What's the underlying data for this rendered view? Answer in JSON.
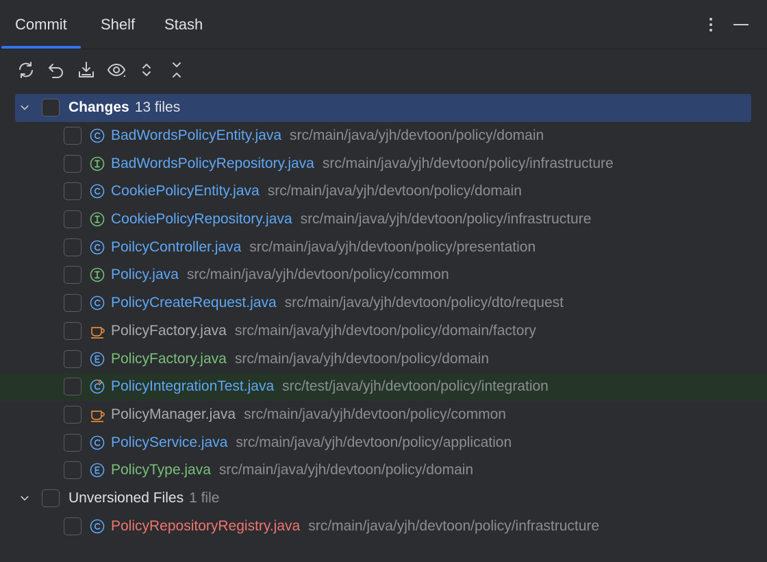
{
  "tabs": [
    {
      "label": "Commit",
      "active": true
    },
    {
      "label": "Shelf",
      "active": false
    },
    {
      "label": "Stash",
      "active": false
    }
  ],
  "header_actions": [
    "more-options-icon",
    "minimize-icon"
  ],
  "toolbar": [
    "refresh-icon",
    "rollback-icon",
    "update-project-icon",
    "view-options-icon",
    "expand-all-icon",
    "collapse-all-icon"
  ],
  "groups": [
    {
      "title": "Changes",
      "count": "13 files",
      "files": [
        {
          "name": "BadWordsPolicyEntity.java",
          "path": "src/main/java/yjh/devtoon/policy/domain",
          "icon": "class-icon",
          "color": "#5fa7f5"
        },
        {
          "name": "BadWordsPolicyRepository.java",
          "path": "src/main/java/yjh/devtoon/policy/infrastructure",
          "icon": "interface-icon",
          "color": "#5fa7f5"
        },
        {
          "name": "CookiePolicyEntity.java",
          "path": "src/main/java/yjh/devtoon/policy/domain",
          "icon": "class-icon",
          "color": "#5fa7f5"
        },
        {
          "name": "CookiePolicyRepository.java",
          "path": "src/main/java/yjh/devtoon/policy/infrastructure",
          "icon": "interface-icon",
          "color": "#5fa7f5"
        },
        {
          "name": "PoilcyController.java",
          "path": "src/main/java/yjh/devtoon/policy/presentation",
          "icon": "class-icon",
          "color": "#5fa7f5"
        },
        {
          "name": "Policy.java",
          "path": "src/main/java/yjh/devtoon/policy/common",
          "icon": "interface-icon",
          "color": "#5fa7f5"
        },
        {
          "name": "PolicyCreateRequest.java",
          "path": "src/main/java/yjh/devtoon/policy/dto/request",
          "icon": "class-icon",
          "color": "#5fa7f5"
        },
        {
          "name": "PolicyFactory.java",
          "path": "src/main/java/yjh/devtoon/policy/domain/factory",
          "icon": "java-file-icon",
          "color": "#a8abb0"
        },
        {
          "name": "PolicyFactory.java",
          "path": "src/main/java/yjh/devtoon/policy/domain",
          "icon": "enum-icon",
          "color": "#79c07a"
        },
        {
          "name": "PolicyIntegrationTest.java",
          "path": "src/test/java/yjh/devtoon/policy/integration",
          "icon": "test-class-icon",
          "color": "#5fa7f5",
          "highlight": true
        },
        {
          "name": "PolicyManager.java",
          "path": "src/main/java/yjh/devtoon/policy/common",
          "icon": "java-file-icon",
          "color": "#a8abb0"
        },
        {
          "name": "PolicyService.java",
          "path": "src/main/java/yjh/devtoon/policy/application",
          "icon": "class-icon",
          "color": "#5fa7f5"
        },
        {
          "name": "PolicyType.java",
          "path": "src/main/java/yjh/devtoon/policy/domain",
          "icon": "enum-icon",
          "color": "#79c07a"
        }
      ]
    },
    {
      "title": "Unversioned Files",
      "count": "1 file",
      "files": [
        {
          "name": "PolicyRepositoryRegistry.java",
          "path": "src/main/java/yjh/devtoon/policy/infrastructure",
          "icon": "class-icon",
          "color": "#f0756e"
        }
      ]
    }
  ]
}
